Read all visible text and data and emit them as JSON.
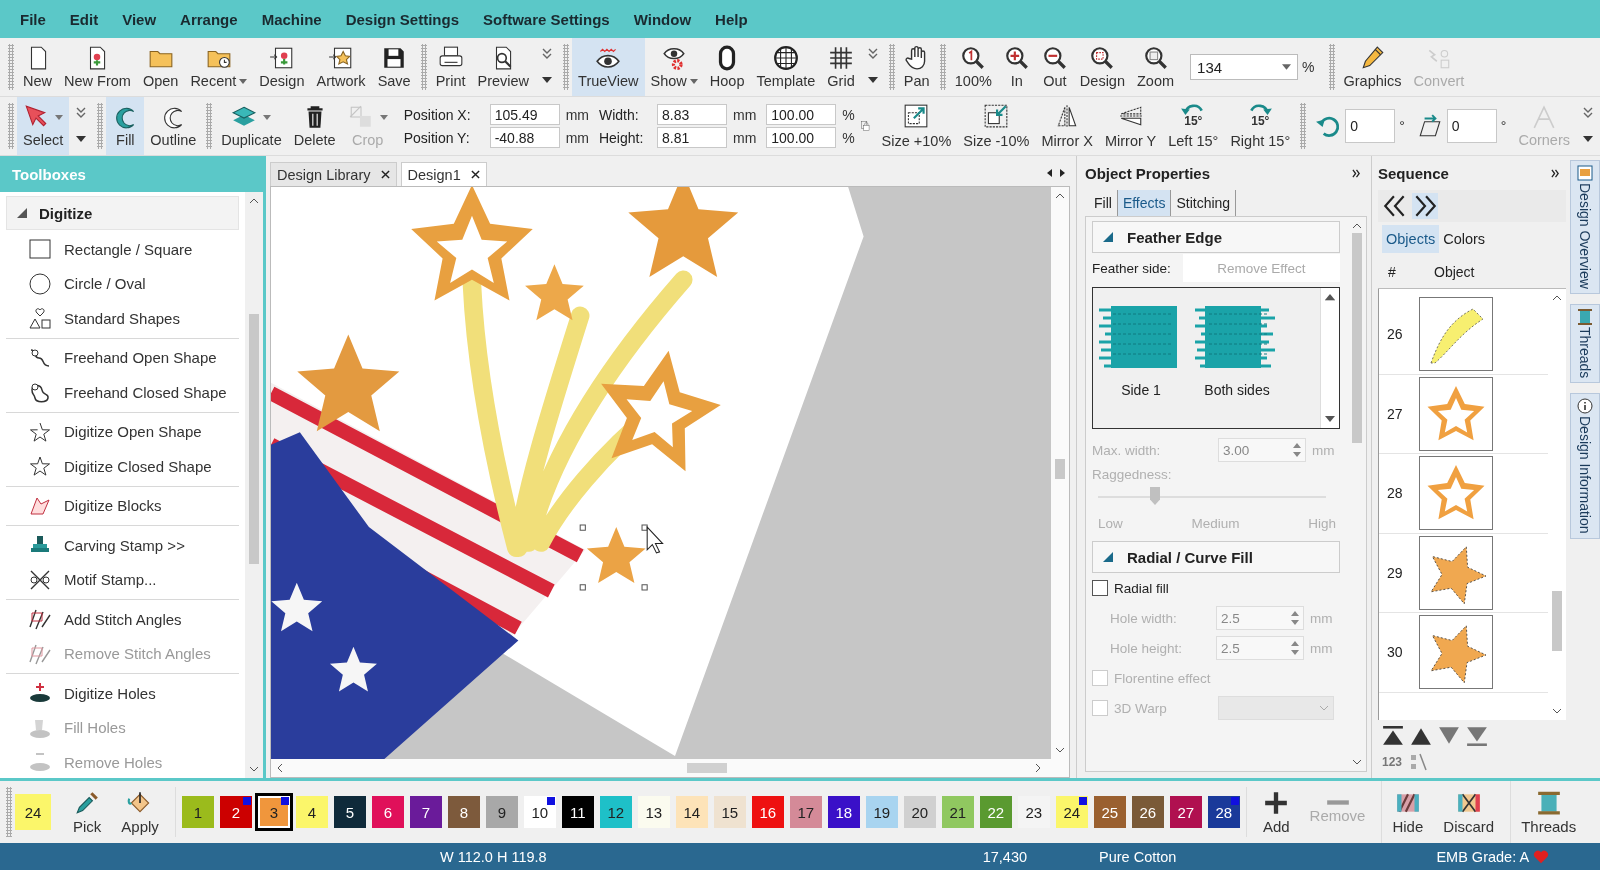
{
  "menu": [
    "File",
    "Edit",
    "View",
    "Arrange",
    "Machine",
    "Design Settings",
    "Software Settings",
    "Window",
    "Help"
  ],
  "toolbar_top": {
    "groups": [
      [
        {
          "label": "New",
          "dropdown": false,
          "selected": false,
          "disabled": false
        },
        {
          "label": "New From",
          "dropdown": false,
          "selected": false,
          "disabled": false
        },
        {
          "label": "Open",
          "dropdown": false,
          "selected": false,
          "disabled": false
        },
        {
          "label": "Recent",
          "dropdown": true,
          "selected": false,
          "disabled": false
        },
        {
          "label": "Design",
          "dropdown": false,
          "selected": false,
          "disabled": false
        },
        {
          "label": "Artwork",
          "dropdown": false,
          "selected": false,
          "disabled": false
        },
        {
          "label": "Save",
          "dropdown": false,
          "selected": false,
          "disabled": false
        }
      ],
      [
        {
          "label": "Print",
          "dropdown": false,
          "selected": false,
          "disabled": false
        },
        {
          "label": "Preview",
          "dropdown": false,
          "selected": false,
          "disabled": false
        }
      ],
      [
        {
          "label": "TrueView",
          "dropdown": false,
          "selected": true,
          "disabled": false
        },
        {
          "label": "Show",
          "dropdown": true,
          "selected": false,
          "disabled": false
        },
        {
          "label": "Hoop",
          "dropdown": false,
          "selected": false,
          "disabled": false
        },
        {
          "label": "Template",
          "dropdown": false,
          "selected": false,
          "disabled": false
        },
        {
          "label": "Grid",
          "dropdown": false,
          "selected": false,
          "disabled": false
        }
      ],
      [
        {
          "label": "Pan",
          "dropdown": false,
          "selected": false,
          "disabled": false
        }
      ],
      [
        {
          "label": "100%",
          "dropdown": false,
          "selected": false,
          "disabled": false
        },
        {
          "label": "In",
          "dropdown": false,
          "selected": false,
          "disabled": false
        },
        {
          "label": "Out",
          "dropdown": false,
          "selected": false,
          "disabled": false
        },
        {
          "label": "Design",
          "dropdown": false,
          "selected": false,
          "disabled": false
        },
        {
          "label": "Zoom",
          "dropdown": false,
          "selected": false,
          "disabled": false
        }
      ],
      [
        {
          "label": "Graphics",
          "dropdown": false,
          "selected": false,
          "disabled": false
        },
        {
          "label": "Convert",
          "dropdown": false,
          "selected": false,
          "disabled": true
        }
      ]
    ],
    "zoom": {
      "value": "134",
      "unit": "%"
    }
  },
  "toolbar_bottom": {
    "groups": [
      [
        {
          "label": "Select",
          "dropdown": true,
          "selected": true,
          "disabled": false
        }
      ],
      [
        {
          "label": "Fill",
          "dropdown": false,
          "selected": true,
          "disabled": false
        },
        {
          "label": "Outline",
          "dropdown": false,
          "selected": false,
          "disabled": false
        }
      ],
      [
        {
          "label": "Duplicate",
          "dropdown": true,
          "selected": false,
          "disabled": false
        },
        {
          "label": "Delete",
          "dropdown": false,
          "selected": false,
          "disabled": false
        },
        {
          "label": "Crop",
          "dropdown": true,
          "selected": false,
          "disabled": true
        }
      ]
    ],
    "position": [
      {
        "label": "Position X:",
        "value": "105.49",
        "unit": "mm"
      },
      {
        "label": "Position Y:",
        "value": "-40.88",
        "unit": "mm"
      }
    ],
    "size": [
      {
        "label": "Width:",
        "value": "8.83",
        "unit": "mm"
      },
      {
        "label": "Height:",
        "value": "8.81",
        "unit": "mm"
      }
    ],
    "scale": [
      {
        "value": "100.00",
        "unit": "%"
      },
      {
        "value": "100.00",
        "unit": "%"
      }
    ],
    "transforms": [
      {
        "label": "Size +10%",
        "selected": false,
        "disabled": false
      },
      {
        "label": "Size -10%",
        "selected": false,
        "disabled": false
      },
      {
        "label": "Mirror X",
        "selected": false,
        "disabled": false
      },
      {
        "label": "Mirror Y",
        "selected": false,
        "disabled": false
      },
      {
        "label": "Left 15°",
        "icon_text": "15°",
        "selected": false,
        "disabled": false
      },
      {
        "label": "Right 15°",
        "icon_text": "15°",
        "selected": false,
        "disabled": false
      }
    ],
    "rotation": {
      "value": "0",
      "unit": "°"
    },
    "skew": {
      "value": "0",
      "unit": "°"
    },
    "corners": {
      "label": "Corners",
      "selected": false,
      "disabled": true
    }
  },
  "toolboxes": {
    "title": "Toolboxes",
    "section": {
      "title": "Digitize",
      "expanded": true,
      "groups": [
        [
          {
            "label": "Rectangle / Square",
            "disabled": false
          },
          {
            "label": "Circle / Oval",
            "disabled": false
          },
          {
            "label": "Standard Shapes",
            "disabled": false
          }
        ],
        [
          {
            "label": "Freehand Open Shape",
            "disabled": false
          },
          {
            "label": "Freehand Closed Shape",
            "disabled": false
          }
        ],
        [
          {
            "label": "Digitize Open Shape",
            "disabled": false
          },
          {
            "label": "Digitize Closed Shape",
            "disabled": false
          }
        ],
        [
          {
            "label": "Digitize Blocks",
            "disabled": false
          }
        ],
        [
          {
            "label": "Carving Stamp >>",
            "disabled": false
          },
          {
            "label": "Motif Stamp...",
            "disabled": false
          }
        ],
        [
          {
            "label": "Add Stitch Angles",
            "disabled": false
          },
          {
            "label": "Remove Stitch Angles",
            "disabled": true
          }
        ],
        [
          {
            "label": "Digitize Holes",
            "disabled": false
          },
          {
            "label": "Fill Holes",
            "disabled": true
          },
          {
            "label": "Remove Holes",
            "disabled": true
          }
        ]
      ]
    }
  },
  "design_tabs": [
    {
      "label": "Design Library",
      "selected": false
    },
    {
      "label": "Design1",
      "selected": true
    }
  ],
  "properties": {
    "title": "Object Properties",
    "tabs": [
      {
        "label": "Fill",
        "selected": false
      },
      {
        "label": "Effects",
        "selected": true
      },
      {
        "label": "Stitching",
        "selected": false
      }
    ],
    "feather_edge": {
      "title": "Feather Edge",
      "expanded": true,
      "side_label": "Feather side:",
      "remove_button": {
        "label": "Remove Effect",
        "disabled": true
      },
      "options": [
        {
          "label": "Side 1",
          "selected": false
        },
        {
          "label": "Both sides",
          "selected": false
        }
      ],
      "max_width": {
        "label": "Max. width:",
        "value": "3.00",
        "unit": "mm",
        "disabled": true
      },
      "raggedness": {
        "label": "Raggedness:",
        "level": 0.25,
        "disabled": true,
        "ticks": [
          "Low",
          "Medium",
          "High"
        ]
      }
    },
    "radial": {
      "title": "Radial / Curve Fill",
      "expanded": true,
      "radial_fill": {
        "label": "Radial fill",
        "checked": false,
        "disabled": false
      },
      "hole_width": {
        "label": "Hole width:",
        "value": "2.5",
        "unit": "mm",
        "disabled": true
      },
      "hole_height": {
        "label": "Hole height:",
        "value": "2.5",
        "unit": "mm",
        "disabled": true
      },
      "florentine": {
        "label": "Florentine effect",
        "checked": false,
        "disabled": true
      },
      "warp": {
        "label": "3D Warp",
        "checked": false,
        "disabled": true
      }
    }
  },
  "sequence": {
    "title": "Sequence",
    "tabs": [
      {
        "label": "Objects",
        "selected": true
      },
      {
        "label": "Colors",
        "selected": false
      }
    ],
    "columns": [
      "#",
      "Object"
    ],
    "rows": [
      {
        "number": "26"
      },
      {
        "number": "27"
      },
      {
        "number": "28"
      },
      {
        "number": "29"
      },
      {
        "number": "30"
      }
    ],
    "sort_label": "123"
  },
  "side_tabs": [
    {
      "label": "Design Overview"
    },
    {
      "label": "Threads"
    },
    {
      "label": "Design Information"
    }
  ],
  "colorbar": {
    "current": {
      "number": "24",
      "color": "#fbf66a"
    },
    "tools": [
      {
        "label": "Pick"
      },
      {
        "label": "Apply"
      }
    ],
    "swatches": [
      {
        "number": "1",
        "color": "#9bbb1c",
        "marked": false,
        "selected": false
      },
      {
        "number": "2",
        "color": "#cc0000",
        "marked": true,
        "selected": false
      },
      {
        "number": "3",
        "color": "#f0963c",
        "marked": true,
        "selected": true
      },
      {
        "number": "4",
        "color": "#fbf66a",
        "marked": false,
        "selected": false
      },
      {
        "number": "5",
        "color": "#0f2a3a",
        "marked": false,
        "selected": false
      },
      {
        "number": "6",
        "color": "#e0105a",
        "marked": false,
        "selected": false
      },
      {
        "number": "7",
        "color": "#6a1b9a",
        "marked": false,
        "selected": false
      },
      {
        "number": "8",
        "color": "#7d5a3c",
        "marked": false,
        "selected": false
      },
      {
        "number": "9",
        "color": "#a8a8a8",
        "marked": false,
        "selected": false
      },
      {
        "number": "10",
        "color": "#ffffff",
        "marked": true,
        "selected": false
      },
      {
        "number": "11",
        "color": "#000000",
        "marked": false,
        "selected": false
      },
      {
        "number": "12",
        "color": "#1ec0c8",
        "marked": false,
        "selected": false
      },
      {
        "number": "13",
        "color": "#fbfbef",
        "marked": false,
        "selected": false
      },
      {
        "number": "14",
        "color": "#fde3b8",
        "marked": false,
        "selected": false
      },
      {
        "number": "15",
        "color": "#efe2d0",
        "marked": false,
        "selected": false
      },
      {
        "number": "16",
        "color": "#ee1111",
        "marked": false,
        "selected": false
      },
      {
        "number": "17",
        "color": "#d48a98",
        "marked": false,
        "selected": false
      },
      {
        "number": "18",
        "color": "#3a10c8",
        "marked": false,
        "selected": false
      },
      {
        "number": "19",
        "color": "#a8d4f0",
        "marked": false,
        "selected": false
      },
      {
        "number": "20",
        "color": "#d0d0d0",
        "marked": false,
        "selected": false
      },
      {
        "number": "21",
        "color": "#90c860",
        "marked": false,
        "selected": false
      },
      {
        "number": "22",
        "color": "#5a9a30",
        "marked": false,
        "selected": false
      },
      {
        "number": "23",
        "color": "#f4f4f4",
        "marked": false,
        "selected": false
      },
      {
        "number": "24",
        "color": "#fbf66a",
        "marked": true,
        "selected": false
      },
      {
        "number": "25",
        "color": "#9a6030",
        "marked": false,
        "selected": false
      },
      {
        "number": "26",
        "color": "#7a5a38",
        "marked": false,
        "selected": false
      },
      {
        "number": "27",
        "color": "#b01050",
        "marked": false,
        "selected": false
      },
      {
        "number": "28",
        "color": "#1a3a9a",
        "marked": true,
        "selected": false
      }
    ],
    "actions": [
      {
        "label": "Add",
        "disabled": false
      },
      {
        "label": "Remove",
        "disabled": true
      },
      {
        "label": "Hide",
        "disabled": false
      },
      {
        "label": "Discard",
        "disabled": false
      },
      {
        "label": "Threads",
        "disabled": false
      }
    ]
  },
  "status_bar": [
    "W 112.0 H 119.8",
    "17,430",
    "Pure Cotton",
    "EMB Grade: A"
  ]
}
